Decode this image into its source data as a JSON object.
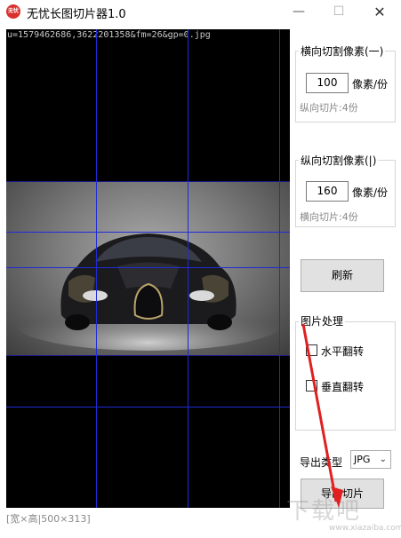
{
  "window": {
    "icon_text": "无忧",
    "title": "无忧长图切片器1.0",
    "min_symbol": "—",
    "max_symbol": "☐",
    "close_symbol": "✕"
  },
  "preview": {
    "filename": "u=1579462686,3622201358&fm=26&gp=0.jpg"
  },
  "status": {
    "text": "[宽×高|500×313]"
  },
  "horizontal_group": {
    "title": "横向切割像素(一)",
    "value": "100",
    "unit": "像素/份",
    "hint": "纵向切片:4份"
  },
  "vertical_group": {
    "title": "纵向切割像素(|)",
    "value": "160",
    "unit": "像素/份",
    "hint": "横向切片:4份"
  },
  "refresh_button": "刷新",
  "image_processing": {
    "title": "图片处理",
    "flip_horizontal": "水平翻转",
    "flip_vertical": "垂直翻转"
  },
  "export": {
    "type_label": "导出类型",
    "type_value": "JPG",
    "button": "导出切片"
  },
  "watermark": {
    "text": "下载吧",
    "sub": "www.xiazaiba.com"
  },
  "colors": {
    "grid_line": "#1f2bd6",
    "arrow": "#e02020"
  }
}
